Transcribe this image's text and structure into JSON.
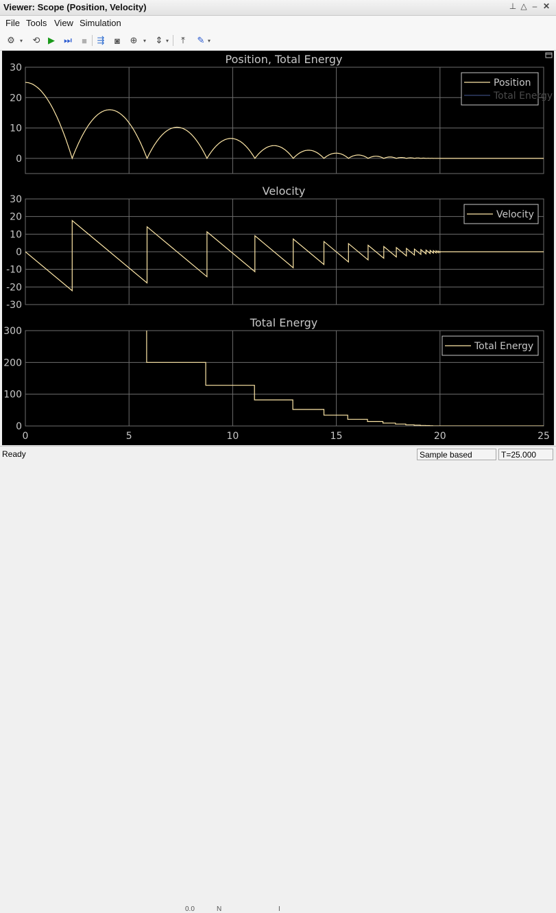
{
  "window": {
    "title": "Viewer: Scope (Position, Velocity)",
    "controls": [
      {
        "name": "pin-icon",
        "glyph": "⊥"
      },
      {
        "name": "undock-icon",
        "glyph": "△"
      },
      {
        "name": "minimize-icon",
        "glyph": "–"
      },
      {
        "name": "close-icon",
        "glyph": "✕"
      }
    ]
  },
  "menu": {
    "items": [
      "File",
      "Tools",
      "View",
      "Simulation"
    ]
  },
  "toolbar": {
    "buttons": [
      {
        "name": "settings-gear-icon",
        "glyph": "⚙",
        "color": "#444444"
      },
      {
        "name": "settings-dropdown-icon",
        "glyph": "▾",
        "small": true
      },
      {
        "name": "step-back-icon",
        "glyph": "⟲",
        "color": "#444444"
      },
      {
        "name": "run-icon",
        "glyph": "▶",
        "color": "#1a9a1a"
      },
      {
        "name": "step-forward-icon",
        "glyph": "⏭",
        "color": "#2a5ad0"
      },
      {
        "name": "stop-icon",
        "glyph": "■",
        "color": "#b0b0b0"
      },
      {
        "name": "highlight-simulink-block-icon",
        "glyph": "⇶",
        "color": "#2a6ad0"
      },
      {
        "name": "snapshot-camera-icon",
        "glyph": "◙",
        "color": "#555555"
      },
      {
        "name": "zoom-icon",
        "glyph": "⊕",
        "color": "#444444"
      },
      {
        "name": "zoom-dropdown-icon",
        "glyph": "▾",
        "small": true
      },
      {
        "name": "scale-axes-icon",
        "glyph": "⇕",
        "color": "#333333"
      },
      {
        "name": "scale-dropdown-icon",
        "glyph": "▾",
        "small": true
      },
      {
        "name": "triggers-icon",
        "glyph": "⤒",
        "color": "#333333"
      },
      {
        "name": "measurements-icon",
        "glyph": "✎",
        "color": "#2a5ad0"
      },
      {
        "name": "measurements-dropdown-icon",
        "glyph": "▾",
        "small": true
      }
    ]
  },
  "status": {
    "text": "Ready",
    "mode": "Sample based",
    "time": "T=25.000"
  },
  "below_window_text": [
    "0.0",
    "N",
    "I"
  ],
  "colors": {
    "plot_background": "#000000",
    "grid": "#6e6e6e",
    "axes_text": "#c8c8c8",
    "signal": "#ffe8a8",
    "energy_legend": "#3a4a7a"
  },
  "chart_data": [
    {
      "type": "line",
      "title": "Position, Total Energy",
      "xlim": [
        0,
        25
      ],
      "ylim": [
        -5,
        30
      ],
      "x_ticks": [
        0,
        5,
        10,
        15,
        20,
        25
      ],
      "y_ticks": [
        0,
        10,
        20,
        30
      ],
      "y_tick_labels": [
        "0",
        "10",
        "20",
        "30"
      ],
      "show_x_tick_labels": false,
      "grid": true,
      "legend": {
        "placement": "top-right",
        "entries": [
          "Position",
          "Total Energy"
        ]
      },
      "series": [
        {
          "name": "Position",
          "kind": "bounce",
          "h0": 25,
          "g": 9.81,
          "restitution": 0.8,
          "t_end": 20,
          "t_max": 25,
          "color": "#ffe8a8"
        },
        {
          "name": "Total Energy",
          "kind": "empty",
          "color": "#3a4a7a"
        }
      ]
    },
    {
      "type": "line",
      "title": "Velocity",
      "xlim": [
        0,
        25
      ],
      "ylim": [
        -30,
        30
      ],
      "x_ticks": [
        0,
        5,
        10,
        15,
        20,
        25
      ],
      "y_ticks": [
        -30,
        -20,
        -10,
        0,
        10,
        20,
        30
      ],
      "y_tick_labels": [
        "-30",
        "-20",
        "-10",
        "0",
        "10",
        "20",
        "30"
      ],
      "show_x_tick_labels": false,
      "grid": true,
      "legend": {
        "placement": "top-right",
        "entries": [
          "Velocity"
        ]
      },
      "series": [
        {
          "name": "Velocity",
          "kind": "bounce_velocity",
          "h0": 25,
          "g": 9.81,
          "restitution": 0.8,
          "t_end": 20,
          "t_max": 25,
          "color": "#ffe8a8"
        }
      ]
    },
    {
      "type": "line",
      "title": "Total Energy",
      "xlim": [
        0,
        25
      ],
      "ylim": [
        0,
        300
      ],
      "x_ticks": [
        0,
        5,
        10,
        15,
        20,
        25
      ],
      "x_tick_labels": [
        "0",
        "5",
        "10",
        "15",
        "20",
        "25"
      ],
      "y_ticks": [
        0,
        100,
        200,
        300
      ],
      "y_tick_labels": [
        "0",
        "100",
        "200",
        "300"
      ],
      "show_x_tick_labels": true,
      "grid": true,
      "legend": {
        "placement": "top-right",
        "entries": [
          "Total Energy"
        ]
      },
      "series": [
        {
          "name": "Total Energy",
          "kind": "step",
          "color": "#ffe8a8",
          "x": [
            5.85,
            5.85,
            8.7,
            8.7,
            11.05,
            11.05,
            12.9,
            12.9,
            14.4,
            14.4,
            15.55,
            15.55,
            16.5,
            16.5,
            17.25,
            17.25,
            17.85,
            17.85,
            18.35,
            18.35,
            18.75,
            18.75,
            19.05,
            19.05,
            19.3,
            19.3,
            19.5,
            19.5,
            19.65,
            19.65,
            20,
            25
          ],
          "y": [
            320,
            200,
            200,
            128,
            128,
            82,
            82,
            52,
            52,
            34,
            34,
            21,
            21,
            14,
            14,
            9,
            9,
            6,
            6,
            3.7,
            3.7,
            2.4,
            2.4,
            1.5,
            1.5,
            1.0,
            1.0,
            0.6,
            0.6,
            0.3,
            0,
            0
          ]
        }
      ]
    }
  ]
}
